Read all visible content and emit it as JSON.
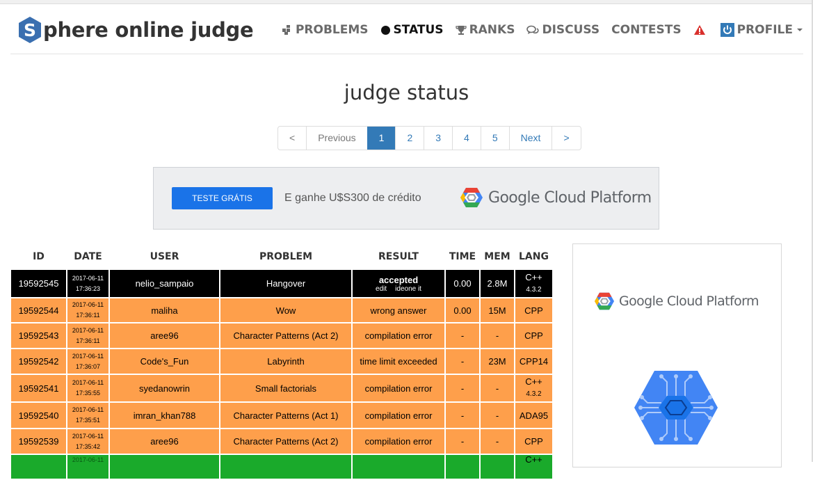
{
  "brand": {
    "letter": "S",
    "rest": "phere online judge"
  },
  "nav": {
    "items": [
      {
        "label": "PROBLEMS",
        "icon": "puzzle-icon"
      },
      {
        "label": "STATUS",
        "icon": "circle-icon"
      },
      {
        "label": "RANKS",
        "icon": "trophy-icon"
      },
      {
        "label": "DISCUSS",
        "icon": "comments-icon"
      },
      {
        "label": "CONTESTS",
        "icon": ""
      },
      {
        "label": "",
        "icon": "warning-icon"
      },
      {
        "label": "PROFILE",
        "icon": "power-icon"
      }
    ],
    "colors": {
      "warning": "#d9302c",
      "profile": "#337ab7"
    }
  },
  "page_title": "judge status",
  "pagination": {
    "prev_arrow": "<",
    "previous": "Previous",
    "pages": [
      "1",
      "2",
      "3",
      "4",
      "5"
    ],
    "current": "1",
    "next": "Next",
    "next_arrow": ">"
  },
  "ad_banner": {
    "button": "TESTE GRÁTIS",
    "text": "E ganhe U$S300 de crédito",
    "brand": "Google Cloud Platform"
  },
  "side_ad": {
    "brand": "Google Cloud Platform"
  },
  "table": {
    "headers": [
      "ID",
      "DATE",
      "USER",
      "PROBLEM",
      "RESULT",
      "TIME",
      "MEM",
      "LANG"
    ],
    "rows": [
      {
        "id": "19592545",
        "date": "2017-06-11",
        "time_of_day": "17:36:23",
        "user": "nelio_sampaio",
        "problem": "Hangover",
        "result": "accepted",
        "links": [
          "edit",
          "ideone it"
        ],
        "time": "0.00",
        "mem": "2.8M",
        "lang": "C++",
        "lang_ver": "4.3.2",
        "status": "accepted"
      },
      {
        "id": "19592544",
        "date": "2017-06-11",
        "time_of_day": "17:36:11",
        "user": "maliha",
        "problem": "Wow",
        "result": "wrong answer",
        "time": "0.00",
        "mem": "15M",
        "lang": "CPP",
        "lang_ver": "",
        "status": "other"
      },
      {
        "id": "19592543",
        "date": "2017-06-11",
        "time_of_day": "17:36:11",
        "user": "aree96",
        "problem": "Character Patterns (Act 2)",
        "result": "compilation error",
        "time": "-",
        "mem": "-",
        "lang": "CPP",
        "lang_ver": "",
        "status": "other"
      },
      {
        "id": "19592542",
        "date": "2017-06-11",
        "time_of_day": "17:36:07",
        "user": "Code's_Fun",
        "problem": "Labyrinth",
        "result": "time limit exceeded",
        "time": "-",
        "mem": "23M",
        "lang": "CPP14",
        "lang_ver": "",
        "status": "other"
      },
      {
        "id": "19592541",
        "date": "2017-06-11",
        "time_of_day": "17:35:55",
        "user": "syedanowrin",
        "problem": "Small factorials",
        "result": "compilation error",
        "time": "-",
        "mem": "-",
        "lang": "C++",
        "lang_ver": "4.3.2",
        "status": "other"
      },
      {
        "id": "19592540",
        "date": "2017-06-11",
        "time_of_day": "17:35:51",
        "user": "imran_khan788",
        "problem": "Character Patterns (Act 1)",
        "result": "compilation error",
        "time": "-",
        "mem": "-",
        "lang": "ADA95",
        "lang_ver": "",
        "status": "other"
      },
      {
        "id": "19592539",
        "date": "2017-06-11",
        "time_of_day": "17:35:42",
        "user": "aree96",
        "problem": "Character Patterns (Act 2)",
        "result": "compilation error",
        "time": "-",
        "mem": "-",
        "lang": "CPP",
        "lang_ver": "",
        "status": "other"
      },
      {
        "id": "",
        "date": "2017-06-11",
        "time_of_day": "",
        "user": "",
        "problem": "",
        "result": "",
        "time": "",
        "mem": "",
        "lang": "C++",
        "lang_ver": "",
        "status": "green"
      }
    ],
    "colors": {
      "accepted": "#000000",
      "other": "#fe9f4b",
      "green": "#1aaa2b"
    }
  }
}
